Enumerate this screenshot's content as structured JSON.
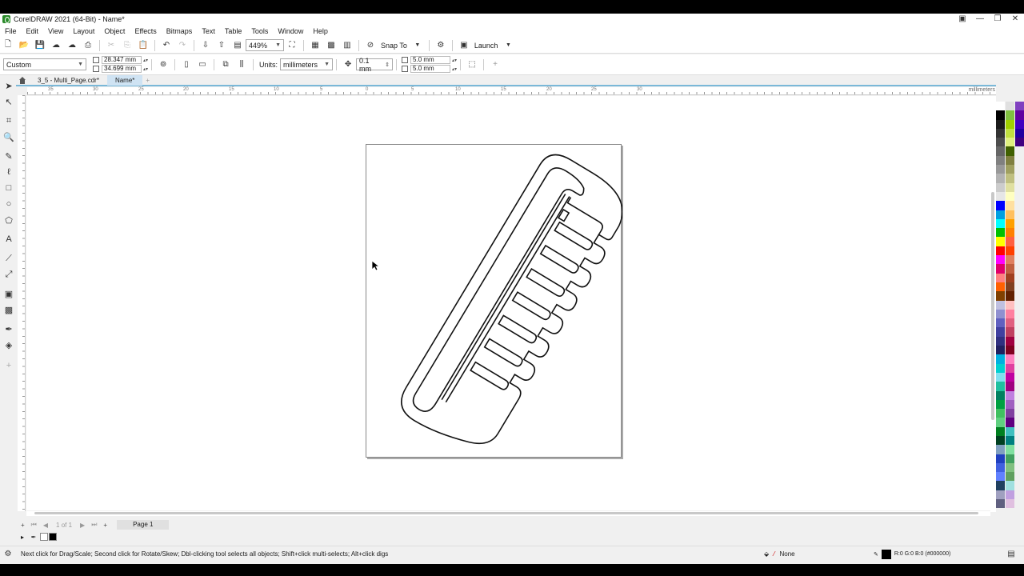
{
  "window": {
    "title": "CorelDRAW 2021 (64-Bit) - Name*"
  },
  "menu": [
    "File",
    "Edit",
    "View",
    "Layout",
    "Object",
    "Effects",
    "Bitmaps",
    "Text",
    "Table",
    "Tools",
    "Window",
    "Help"
  ],
  "toolbar": {
    "zoom": "449%",
    "snap_label": "Snap To",
    "launch_label": "Launch"
  },
  "propbar": {
    "preset": "Custom",
    "width": "28.347 mm",
    "height": "34.699 mm",
    "units_label": "Units:",
    "units": "millimeters",
    "nudge": "0.1 mm",
    "dup_x": "5.0 mm",
    "dup_y": "5.0 mm"
  },
  "tabs": [
    {
      "label": "3_5 - Multi_Page.cdr*"
    },
    {
      "label": "Name*"
    }
  ],
  "ruler": {
    "unit": "millimeters",
    "h_labels": [
      "35",
      "30",
      "25",
      "20",
      "15",
      "10",
      "5",
      "0",
      "5",
      "10",
      "15",
      "20",
      "25",
      "30"
    ]
  },
  "pagenav": {
    "count": "1 of 1",
    "page": "Page 1"
  },
  "status": {
    "message": "Next click for Drag/Scale; Second click for Rotate/Skew; Dbl-clicking tool selects all objects; Shift+click multi-selects; Alt+click digs",
    "fill": "None",
    "outline": "R:0 G:0 B:0 (#000000)"
  },
  "palette": {
    "col1": [
      "#ffffff",
      "#000000",
      "#1a1a1a",
      "#333333",
      "#4d4d4d",
      "#666666",
      "#808080",
      "#999999",
      "#b3b3b3",
      "#cccccc",
      "#e6e6e6",
      "#0000ff",
      "#00a0e0",
      "#00ffff",
      "#00c000",
      "#ffff00",
      "#ff0000",
      "#ff00ff",
      "#e0006a",
      "#ff8080",
      "#ff6000",
      "#804000",
      "#c0c0e0",
      "#9090d0",
      "#6060c0",
      "#4040a0",
      "#303080",
      "#202060",
      "#00b0e0",
      "#00d0d0",
      "#80e0f0",
      "#20c0a0",
      "#008060",
      "#00a040",
      "#40c060",
      "#60d080",
      "#008020",
      "#004020",
      "#80a0c0",
      "#2040c0",
      "#4060e0",
      "#6080ff",
      "#204060",
      "#a0a0c0",
      "#606080"
    ],
    "col2": [
      "#e0e0e0",
      "#80c040",
      "#a0d000",
      "#c0e040",
      "#e0f080",
      "#406000",
      "#808040",
      "#a0a060",
      "#c0c080",
      "#e0e0a0",
      "#ffffc0",
      "#ffe0a0",
      "#ffc060",
      "#ffa000",
      "#ff8000",
      "#ff6040",
      "#ff4000",
      "#e08060",
      "#c06040",
      "#a04020",
      "#804020",
      "#602000",
      "#ffc0c0",
      "#ff80a0",
      "#e06080",
      "#c04060",
      "#a00040",
      "#800020",
      "#ff80c0",
      "#e040a0",
      "#c000a0",
      "#a00080",
      "#c080e0",
      "#a060c0",
      "#8040a0",
      "#600080",
      "#40c0c0",
      "#008080",
      "#80e0a0",
      "#40a060",
      "#80c080",
      "#60a060",
      "#a0e0e0",
      "#c0a0e0",
      "#e0c0e0"
    ],
    "col3": [
      "#8040c0",
      "#6000a0",
      "#4000c0",
      "#2000a0",
      "#400080"
    ]
  }
}
